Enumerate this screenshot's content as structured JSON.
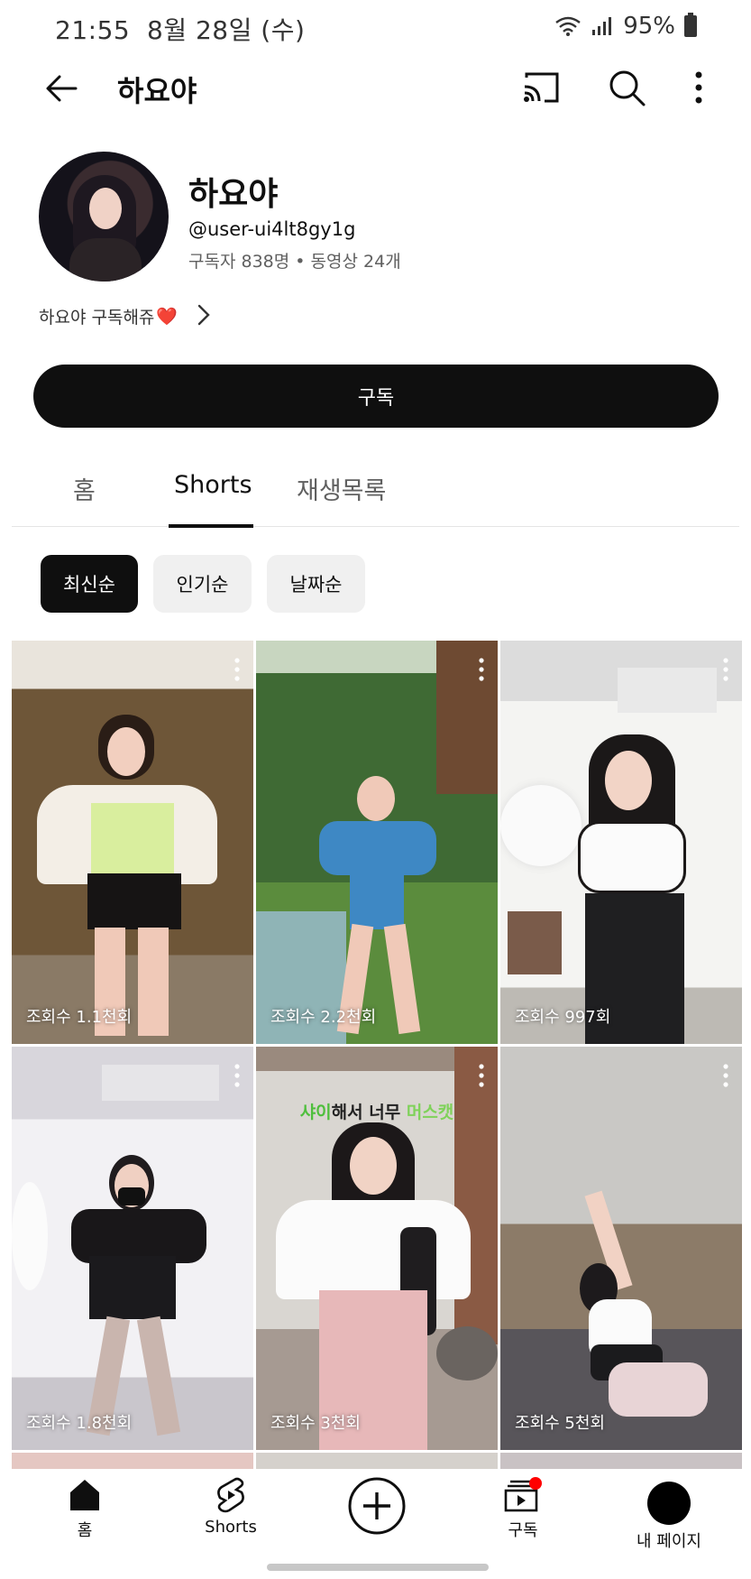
{
  "status_bar": {
    "time": "21:55",
    "date": "8월 28일 (수)",
    "battery": "95%"
  },
  "top_bar": {
    "title": "하요야"
  },
  "channel": {
    "name": "하요야",
    "handle": "@user-ui4lt8gy1g",
    "subscribers": "구독자 838명",
    "separator": "•",
    "videos": "동영상 24개",
    "description": "하요야 구독해쥬",
    "description_emoji": "❤️"
  },
  "subscribe_label": "구독",
  "tabs": [
    {
      "label": "홈"
    },
    {
      "label": "Shorts"
    },
    {
      "label": "재생목록"
    }
  ],
  "chips": [
    {
      "label": "최신순"
    },
    {
      "label": "인기순"
    },
    {
      "label": "날짜순"
    }
  ],
  "shorts": [
    {
      "views": "조회수 1.1천회"
    },
    {
      "views": "조회수 2.2천회"
    },
    {
      "views": "조회수 997회"
    },
    {
      "views": "조회수 1.8천회"
    },
    {
      "views": "조회수 3천회",
      "overlay_text_a": "샤이",
      "overlay_text_b": "해서 너무",
      "overlay_text_c": "머스캣"
    },
    {
      "views": "조회수 5천회"
    }
  ],
  "bottom_nav": [
    {
      "label": "홈",
      "icon": "home-icon"
    },
    {
      "label": "Shorts",
      "icon": "shorts-icon"
    },
    {
      "label": "",
      "icon": "create-plus-icon"
    },
    {
      "label": "구독",
      "icon": "subscriptions-icon"
    },
    {
      "label": "내 페이지",
      "icon": "avatar"
    }
  ],
  "colors": {
    "accent_black": "#0f0f0f",
    "chip_gray": "#f0f0f0",
    "notification_red": "#ff0000"
  }
}
